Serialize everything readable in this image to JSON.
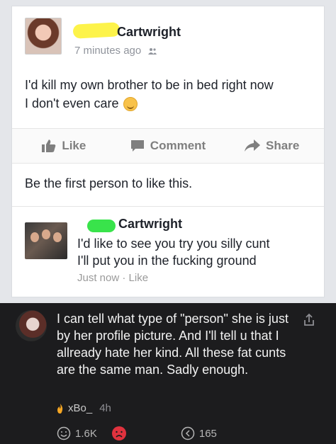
{
  "post": {
    "author": "Cartwright",
    "time": "7 minutes ago",
    "text_line1": "I'd kill my own brother to be in bed right now",
    "text_line2": "I don't even care"
  },
  "actions": {
    "like": "Like",
    "comment": "Comment",
    "share": "Share"
  },
  "likes_text": "Be the first person to like this.",
  "comment": {
    "author": "Cartwright",
    "line1": "I'd like to see you try you silly cunt",
    "line2": "I'll put you in the fucking ground",
    "time": "Just now",
    "separator": "·",
    "like": "Like"
  },
  "reply": {
    "text": "I can tell what type of \"person\" she is just by her profile picture. And I'll tell u that I allready hate her kind. All these fat cunts are the same man. Sadly enough.",
    "author": "xBo_",
    "time": "4h",
    "smile_count": "1.6K",
    "reply_count": "165"
  },
  "colors": {
    "censor_yellow": "#fdf34a",
    "censor_green": "#39e34b",
    "dark_bg": "#1c1c1e",
    "sad_red": "#e0323e"
  }
}
